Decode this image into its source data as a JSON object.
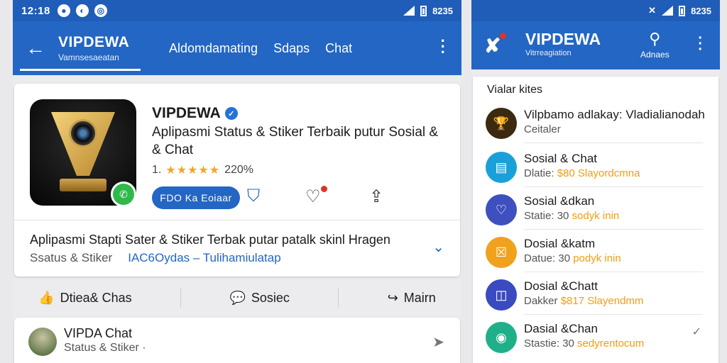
{
  "left": {
    "status": {
      "time": "12:18",
      "battery": "8235"
    },
    "appbar": {
      "title": "VIPDEWA",
      "subtitle": "Vamnsesaeatan",
      "tabs": [
        "Aldomdamating",
        "Sdaps",
        "Chat"
      ]
    },
    "app": {
      "name": "VIPDEWA",
      "description": "Aplipasmi Status & Stiker Terbaik putur Sosial & & Chat",
      "rating_text": "1.",
      "stars": "★★★★★",
      "rating_count": "220%",
      "install_label": "FDO Ka Eoiaar"
    },
    "ad": {
      "line": "Aplipasmi Stapti Sater & Stiker Terbak putar patalk skinl Hragen",
      "sub": "Ssatus & Stiker",
      "link": "IAC6Oydas – Tulihamiulatap"
    },
    "actions": [
      {
        "icon": "thumbs-up-icon",
        "glyph": "👍",
        "label": "Dtiea& Chas"
      },
      {
        "icon": "comment-icon",
        "glyph": "💬",
        "label": "Sosiec"
      },
      {
        "icon": "share-arrow-icon",
        "glyph": "↪",
        "label": "Mairn"
      }
    ],
    "post": {
      "name": "VIPDA Chat",
      "sub": "Status & Stiker ·"
    }
  },
  "right": {
    "status": {
      "battery": "8235"
    },
    "appbar": {
      "title": "VIPDEWA",
      "subtitle": "Vitrreagiation",
      "search_label": "Adnaes"
    },
    "list_header": "Vialar kites",
    "rows": [
      {
        "title": "Vilpbamo adlakay: Vladialianodah",
        "sub": "Ceitaler",
        "highlight": "",
        "color": "#3b2a10",
        "glyph": "🏆"
      },
      {
        "title": "Sosial & Chat",
        "sub": "Dlatie: ",
        "highlight": "$80 Slayordcmna",
        "color": "#1aa0d8",
        "glyph": "▤"
      },
      {
        "title": "Sosial &dkan",
        "sub": "Statie: 30 ",
        "highlight": "sodyk inin",
        "color": "#3e4fc0",
        "glyph": "♡"
      },
      {
        "title": "Dosial &katm",
        "sub": "Datue: 30 ",
        "highlight": "podyk inin",
        "color": "#f0a21c",
        "glyph": "☒"
      },
      {
        "title": "Dosial &Chatt",
        "sub": "Dakker ",
        "highlight": "$817 Slayendmm",
        "color": "#3a4ac0",
        "glyph": "◫"
      },
      {
        "title": "Dasial &Chan",
        "sub": "Stastie: 30 ",
        "highlight": "sedyrentocum",
        "color": "#1fb08a",
        "glyph": "◉"
      }
    ]
  }
}
